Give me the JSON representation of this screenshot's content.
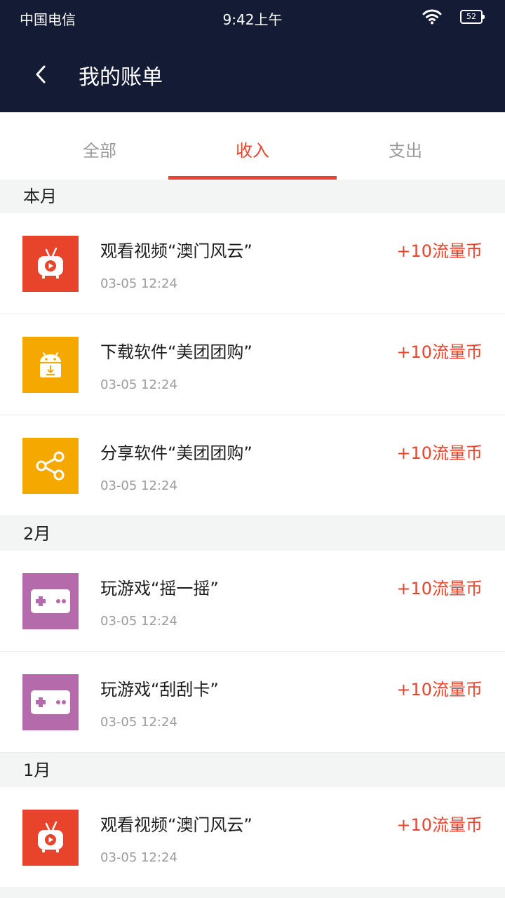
{
  "status": {
    "carrier": "中国电信",
    "time": "9:42上午",
    "battery": "52"
  },
  "header": {
    "title": "我的账单"
  },
  "tabs": [
    {
      "label": "全部",
      "active": false
    },
    {
      "label": "收入",
      "active": true
    },
    {
      "label": "支出",
      "active": false
    }
  ],
  "sections": [
    {
      "label": "本月",
      "items": [
        {
          "icon": "tv-icon",
          "icon_color": "#e8442c",
          "title": "观看视频“澳门风云”",
          "date": "03-05 12:24",
          "amount": "+10流量币"
        },
        {
          "icon": "android-download-icon",
          "icon_color": "#f5a800",
          "title": "下载软件“美团团购”",
          "date": "03-05 12:24",
          "amount": "+10流量币"
        },
        {
          "icon": "share-icon",
          "icon_color": "#f5a800",
          "title": "分享软件“美团团购”",
          "date": "03-05 12:24",
          "amount": "+10流量币"
        }
      ]
    },
    {
      "label": "2月",
      "items": [
        {
          "icon": "gamepad-icon",
          "icon_color": "#b56aab",
          "title": "玩游戏“摇一摇”",
          "date": "03-05 12:24",
          "amount": "+10流量币"
        },
        {
          "icon": "gamepad-icon",
          "icon_color": "#b56aab",
          "title": "玩游戏“刮刮卡”",
          "date": "03-05 12:24",
          "amount": "+10流量币"
        }
      ]
    },
    {
      "label": "1月",
      "items": [
        {
          "icon": "tv-icon",
          "icon_color": "#e8442c",
          "title": "观看视频“澳门风云”",
          "date": "03-05 12:24",
          "amount": "+10流量币"
        }
      ]
    }
  ],
  "colors": {
    "header_bg": "#141c35",
    "accent": "#e8442c",
    "section_bg": "#f3f4f4"
  }
}
